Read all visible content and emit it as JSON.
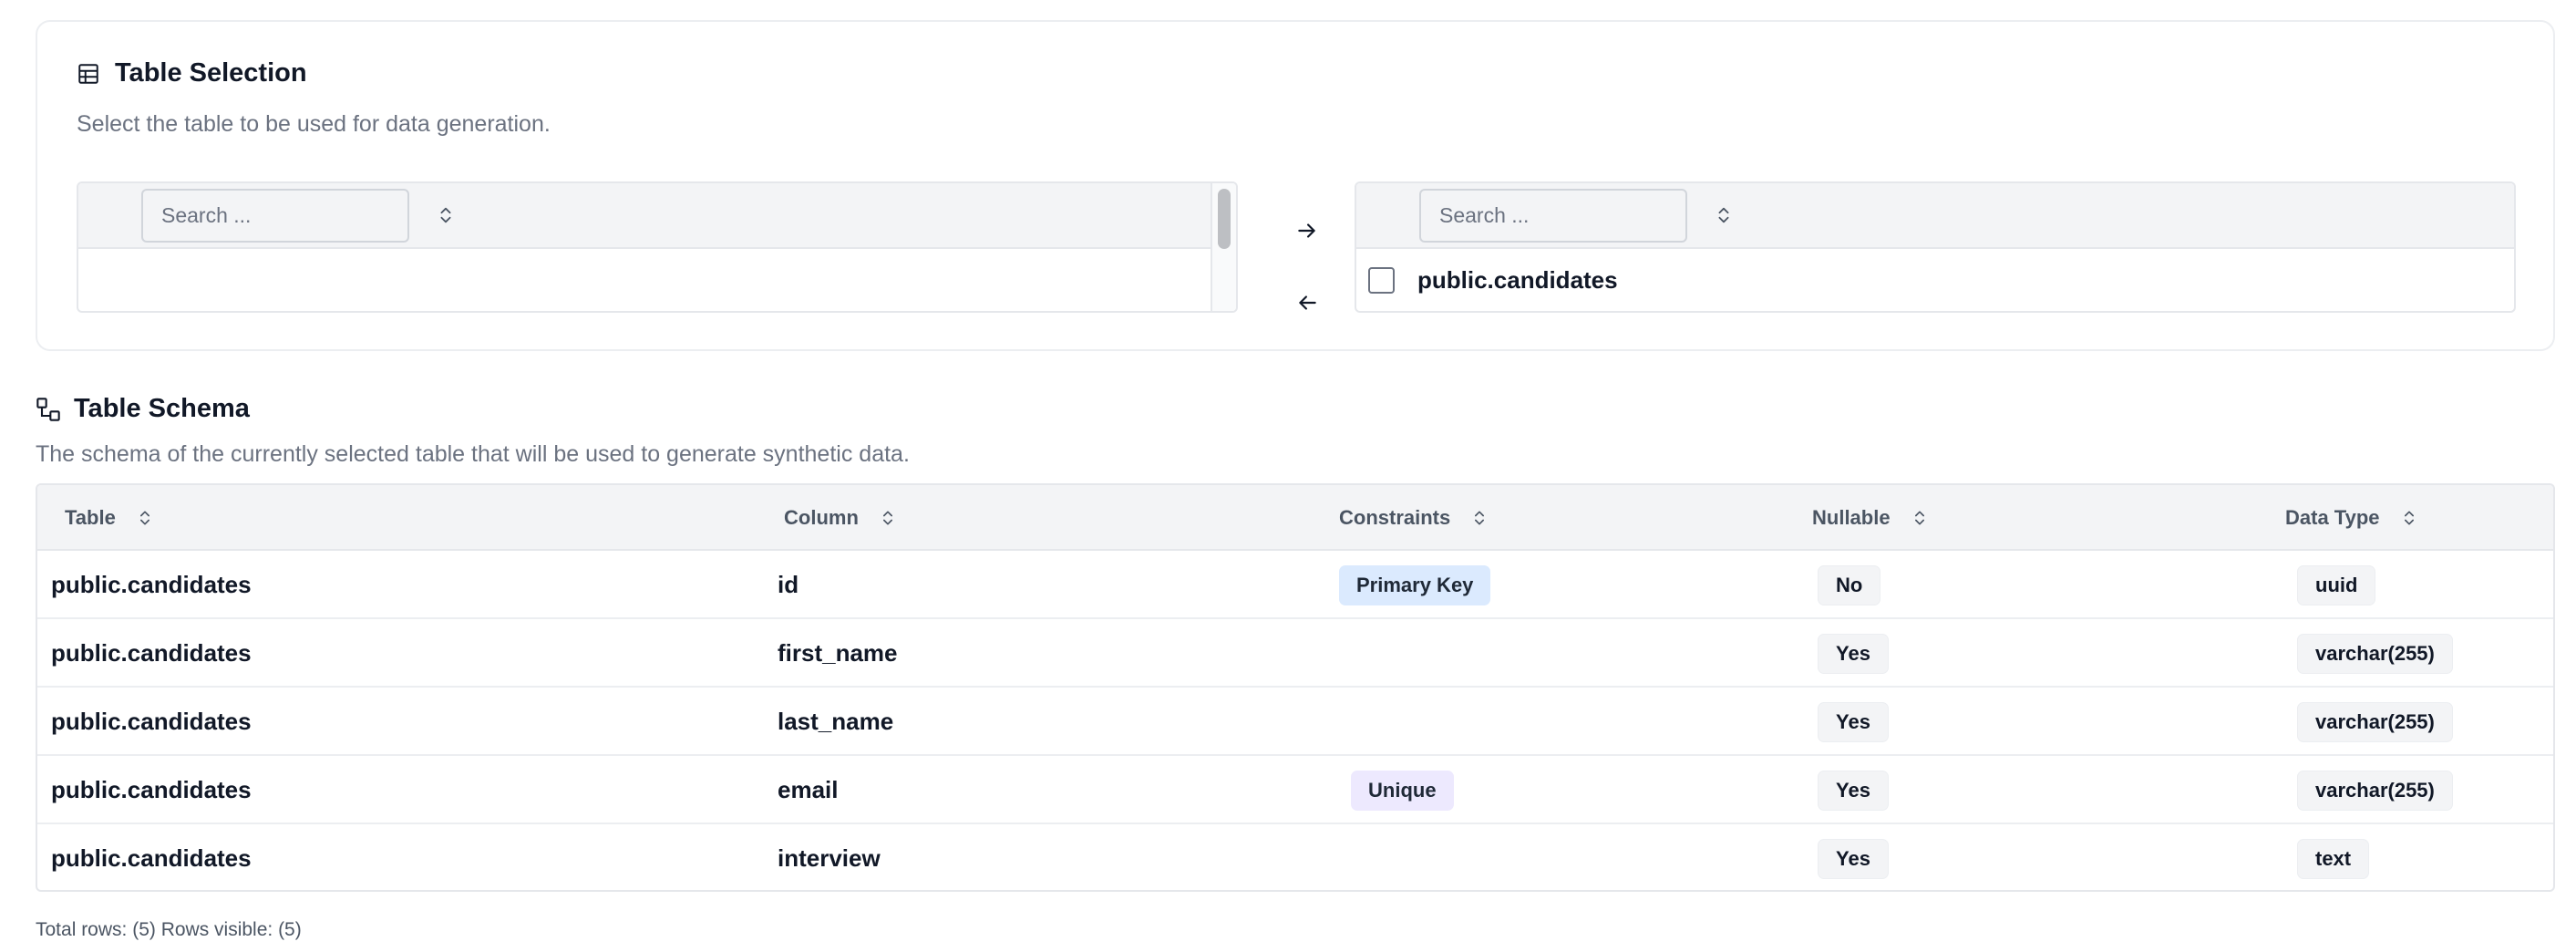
{
  "selection": {
    "title": "Table Selection",
    "description": "Select the table to be used for data generation.",
    "left_list": {
      "search_placeholder": "Search ...",
      "items": []
    },
    "right_list": {
      "search_placeholder": "Search ...",
      "items": [
        "public.candidates"
      ]
    },
    "icons": {
      "title": "table-icon",
      "move_right": "arrow-right-icon",
      "move_left": "arrow-left-icon",
      "sort": "sort-icon"
    }
  },
  "schema": {
    "title": "Table Schema",
    "description": "The schema of the currently selected table that will be used to generate synthetic data.",
    "columns": [
      "Table",
      "Column",
      "Constraints",
      "Nullable",
      "Data Type"
    ],
    "rows": [
      {
        "table": "public.candidates",
        "column": "id",
        "constraint": "Primary Key",
        "nullable": "No",
        "data_type": "uuid"
      },
      {
        "table": "public.candidates",
        "column": "first_name",
        "constraint": "",
        "nullable": "Yes",
        "data_type": "varchar(255)"
      },
      {
        "table": "public.candidates",
        "column": "last_name",
        "constraint": "",
        "nullable": "Yes",
        "data_type": "varchar(255)"
      },
      {
        "table": "public.candidates",
        "column": "email",
        "constraint": "Unique",
        "nullable": "Yes",
        "data_type": "varchar(255)"
      },
      {
        "table": "public.candidates",
        "column": "interview",
        "constraint": "",
        "nullable": "Yes",
        "data_type": "text"
      }
    ],
    "footer": "Total rows: (5) Rows visible: (5)",
    "icons": {
      "title": "schema-icon"
    }
  },
  "colors": {
    "primary_key_badge": "#dbeafe",
    "unique_badge": "#ede9fe",
    "neutral_badge": "#f3f4f6",
    "muted_text": "#6b7280"
  }
}
